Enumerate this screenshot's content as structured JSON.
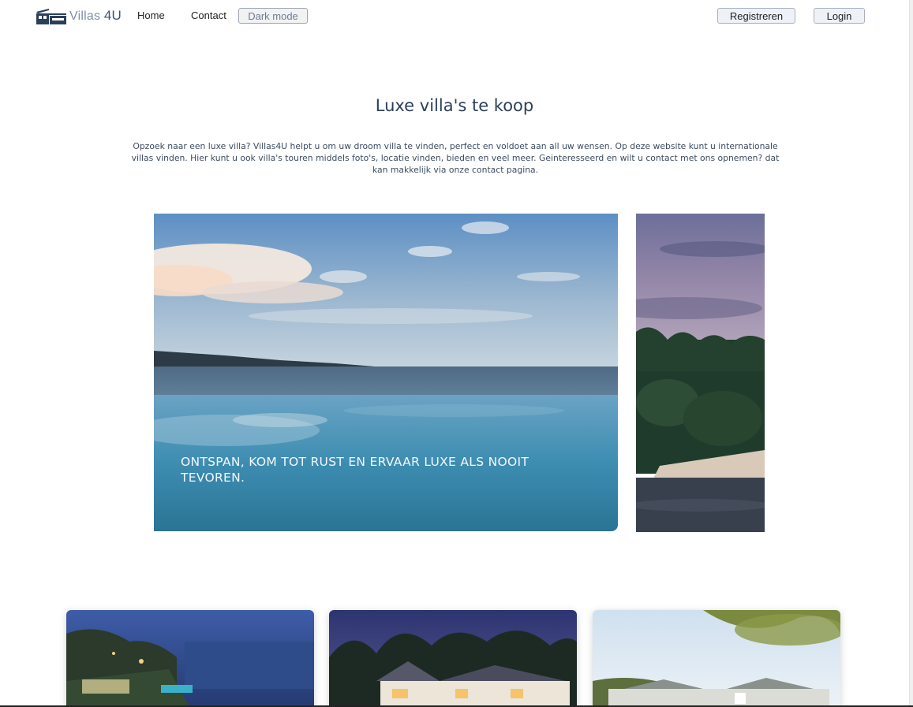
{
  "nav": {
    "brand_name": "Villas",
    "brand_suffix": "4U",
    "links": [
      "Home",
      "Contact"
    ],
    "dark_mode_label": "Dark mode",
    "register_label": "Registreren",
    "login_label": "Login"
  },
  "hero": {
    "title": "Luxe villa's te koop",
    "intro": "Opzoek naar een luxe villa? Villas4U helpt u om uw droom villa te vinden, perfect en voldoet aan all uw wensen. Op deze website kunt u internationale villas vinden. Hier kunt u ook villa's touren middels foto's, locatie vinden, bieden en veel meer. Geinteresseerd en wilt u contact met ons opnemen? dat kan makkelijk via onze contact pagina."
  },
  "carousel": {
    "caption": "ONTSPAN, KOM TOT RUST EN ERVAAR LUXE ALS NOOIT TEVOREN."
  },
  "colors": {
    "brand": "#3b5272",
    "title": "#2b3f5a",
    "button_bg": "#eef2f8"
  },
  "icons": [
    "house-logo-icon"
  ]
}
